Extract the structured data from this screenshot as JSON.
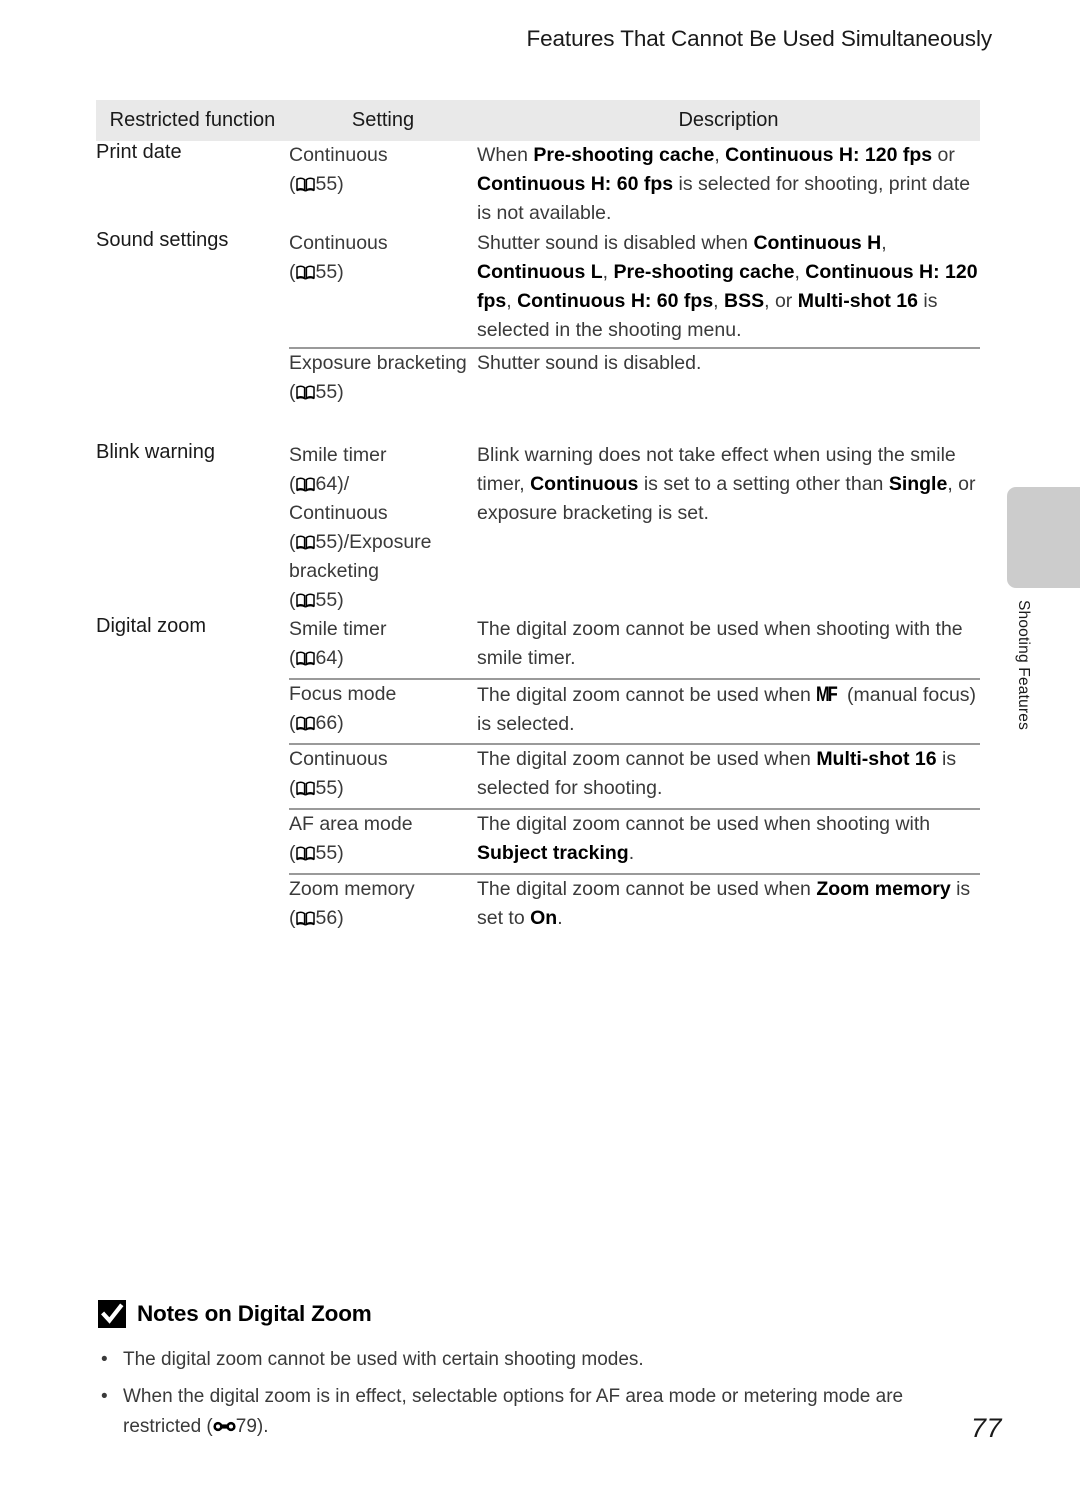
{
  "header": {
    "running_title": "Features That Cannot Be Used Simultaneously"
  },
  "side_tab": {
    "label": "Shooting Features",
    "color": "#cccccc"
  },
  "table": {
    "columns": [
      "Restricted function",
      "Setting",
      "Description"
    ],
    "rows": [
      {
        "function": "Print date",
        "settings": [
          {
            "setting_name": "Continuous",
            "setting_ref_icon": "book-icon",
            "setting_ref_page": "55",
            "description_runs": [
              {
                "text": "When ",
                "bold": false
              },
              {
                "text": "Pre-shooting cache",
                "bold": true
              },
              {
                "text": ", ",
                "bold": false
              },
              {
                "text": "Continuous H: 120 fps",
                "bold": true
              },
              {
                "text": " or ",
                "bold": false
              },
              {
                "text": "Continuous H: 60 fps",
                "bold": true
              },
              {
                "text": " is selected for shooting, print date is not available.",
                "bold": false
              }
            ]
          }
        ]
      },
      {
        "function": "Sound settings",
        "settings": [
          {
            "setting_name": "Continuous",
            "setting_ref_icon": "book-icon",
            "setting_ref_page": "55",
            "description_runs": [
              {
                "text": "Shutter sound is disabled when ",
                "bold": false
              },
              {
                "text": "Continuous H",
                "bold": true
              },
              {
                "text": ", ",
                "bold": false
              },
              {
                "text": "Continuous L",
                "bold": true
              },
              {
                "text": ", ",
                "bold": false
              },
              {
                "text": "Pre-shooting cache",
                "bold": true
              },
              {
                "text": ", ",
                "bold": false
              },
              {
                "text": "Continuous H: 120 fps",
                "bold": true
              },
              {
                "text": ", ",
                "bold": false
              },
              {
                "text": "Continuous H: 60 fps",
                "bold": true
              },
              {
                "text": ", ",
                "bold": false
              },
              {
                "text": "BSS",
                "bold": true
              },
              {
                "text": ", or ",
                "bold": false
              },
              {
                "text": "Multi-shot 16",
                "bold": true
              },
              {
                "text": " is selected in the shooting menu.",
                "bold": false
              }
            ]
          },
          {
            "setting_name": "Exposure bracketing",
            "setting_ref_icon": "book-icon",
            "setting_ref_page": "55",
            "description_runs": [
              {
                "text": "Shutter sound is disabled.",
                "bold": false
              }
            ]
          }
        ]
      },
      {
        "function": "Blink warning",
        "settings": [
          {
            "setting_name": "Smile timer",
            "setting_ref_icon": "book-icon",
            "setting_ref_page": "64",
            "setting_suffix": "/",
            "setting_name_2": "Continuous",
            "setting_ref_page_2": "55",
            "setting_suffix_2": "/Exposure bracketing",
            "setting_ref_page_3": "55",
            "description_runs": [
              {
                "text": "Blink warning does not take effect when using the smile timer, ",
                "bold": false
              },
              {
                "text": "Continuous",
                "bold": true
              },
              {
                "text": " is set to a setting other than ",
                "bold": false
              },
              {
                "text": "Single",
                "bold": true
              },
              {
                "text": ", or exposure bracketing is set.",
                "bold": false
              }
            ]
          }
        ]
      },
      {
        "function": "Digital zoom",
        "settings": [
          {
            "setting_name": "Smile timer",
            "setting_ref_icon": "book-icon",
            "setting_ref_page": "64",
            "description_runs": [
              {
                "text": "The digital zoom cannot be used when shooting with the smile timer.",
                "bold": false
              }
            ]
          },
          {
            "setting_name": "Focus mode",
            "setting_ref_icon": "book-icon",
            "setting_ref_page": "66",
            "description_runs": [
              {
                "text": "The digital zoom cannot be used when ",
                "bold": false
              },
              {
                "text": "MF",
                "bold": true,
                "glyph": "manual-focus-icon"
              },
              {
                "text": " (manual focus) is selected.",
                "bold": false
              }
            ]
          },
          {
            "setting_name": "Continuous",
            "setting_ref_icon": "book-icon",
            "setting_ref_page": "55",
            "description_runs": [
              {
                "text": "The digital zoom cannot be used when ",
                "bold": false
              },
              {
                "text": "Multi-shot 16",
                "bold": true
              },
              {
                "text": " is selected for shooting.",
                "bold": false
              }
            ]
          },
          {
            "setting_name": "AF area mode",
            "setting_ref_icon": "book-icon",
            "setting_ref_page": "55",
            "description_runs": [
              {
                "text": "The digital zoom cannot be used when shooting with ",
                "bold": false
              },
              {
                "text": "Subject tracking",
                "bold": true
              },
              {
                "text": ".",
                "bold": false
              }
            ]
          },
          {
            "setting_name": "Zoom memory",
            "setting_ref_icon": "book-icon",
            "setting_ref_page": "56",
            "description_runs": [
              {
                "text": "The digital zoom cannot be used when ",
                "bold": false
              },
              {
                "text": "Zoom memory",
                "bold": true
              },
              {
                "text": " is set to ",
                "bold": false
              },
              {
                "text": "On",
                "bold": true
              },
              {
                "text": ".",
                "bold": false
              }
            ]
          }
        ]
      }
    ]
  },
  "notes": {
    "icon": "check-square-icon",
    "title": "Notes on Digital Zoom",
    "bullet": "•",
    "items": [
      {
        "runs": [
          {
            "text": "The digital zoom cannot be used with certain shooting modes.",
            "bold": false
          }
        ]
      },
      {
        "runs": [
          {
            "text": "When the digital zoom is in effect, selectable options for AF area mode or metering mode are restricted (",
            "bold": false
          },
          {
            "text": "",
            "bold": false,
            "glyph": "reference-manual-icon"
          },
          {
            "text": "79).",
            "bold": false
          }
        ]
      }
    ]
  },
  "folio": {
    "page_number": "77"
  }
}
